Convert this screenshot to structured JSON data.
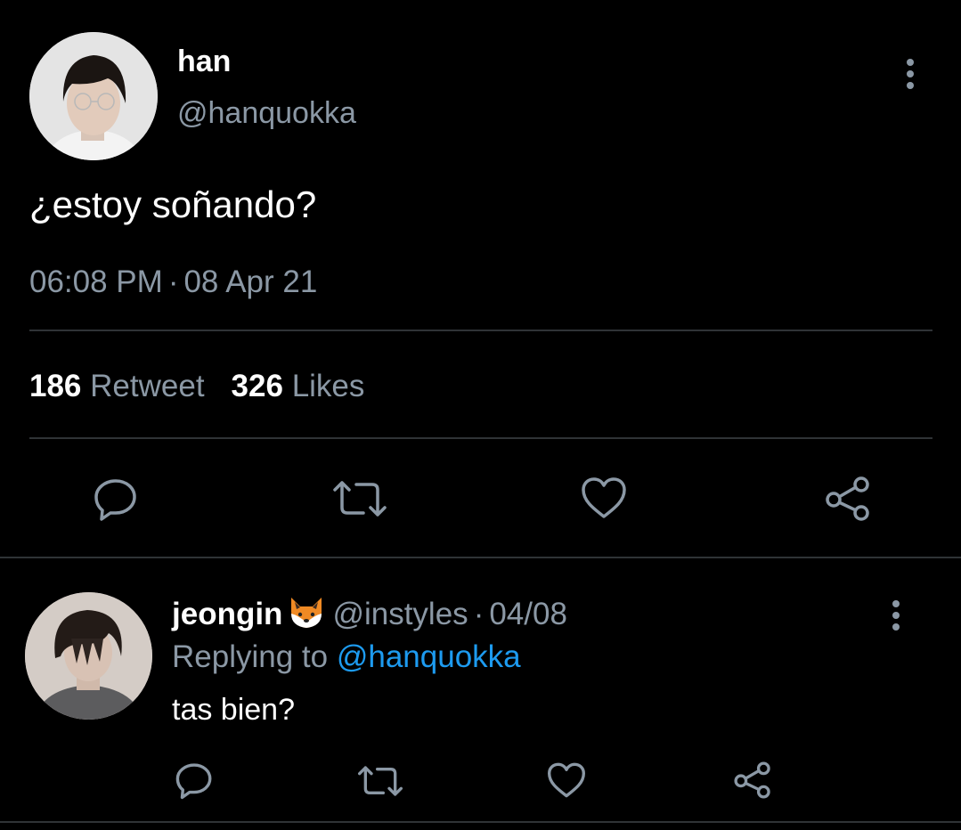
{
  "tweet": {
    "author_name": "han",
    "author_handle": "@hanquokka",
    "text": "¿estoy soñando?",
    "time": "06:08 PM",
    "separator": "·",
    "date": "08 Apr 21",
    "retweet_count": "186",
    "retweet_label": "Retweet",
    "like_count": "326",
    "like_label": "Likes"
  },
  "reply": {
    "author_name": "jeongin",
    "emoji": "fox-face-icon",
    "author_handle": "@instyles",
    "separator": "·",
    "date": "04/08",
    "replying_prefix": "Replying to",
    "replying_to": "@hanquokka",
    "text": "tas bien?"
  },
  "colors": {
    "background": "#000000",
    "primary_text": "#ffffff",
    "secondary_text": "#8b98a5",
    "link": "#1d9bf0",
    "divider": "#2f3336"
  }
}
